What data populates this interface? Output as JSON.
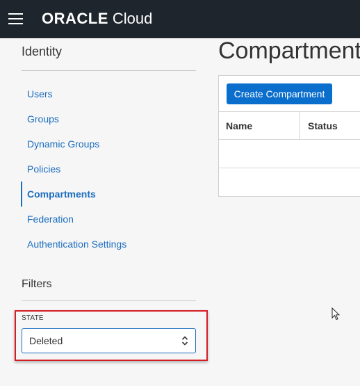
{
  "header": {
    "brand_oracle": "ORACLE",
    "brand_cloud": "Cloud",
    "menu_icon": "hamburger-menu-icon"
  },
  "sidebar": {
    "title": "Identity",
    "items": [
      {
        "label": "Users",
        "active": false
      },
      {
        "label": "Groups",
        "active": false
      },
      {
        "label": "Dynamic Groups",
        "active": false
      },
      {
        "label": "Policies",
        "active": false
      },
      {
        "label": "Compartments",
        "active": true
      },
      {
        "label": "Federation",
        "active": false
      },
      {
        "label": "Authentication Settings",
        "active": false
      }
    ],
    "filters_title": "Filters",
    "state_label": "STATE",
    "state_value": "Deleted"
  },
  "main": {
    "title": "Compartments",
    "create_button": "Create Compartment",
    "columns": [
      "Name",
      "Status"
    ]
  },
  "colors": {
    "header_bg": "#1e252d",
    "link": "#1b6dbf",
    "primary_button": "#0a6ecd",
    "highlight": "#d51d26"
  }
}
